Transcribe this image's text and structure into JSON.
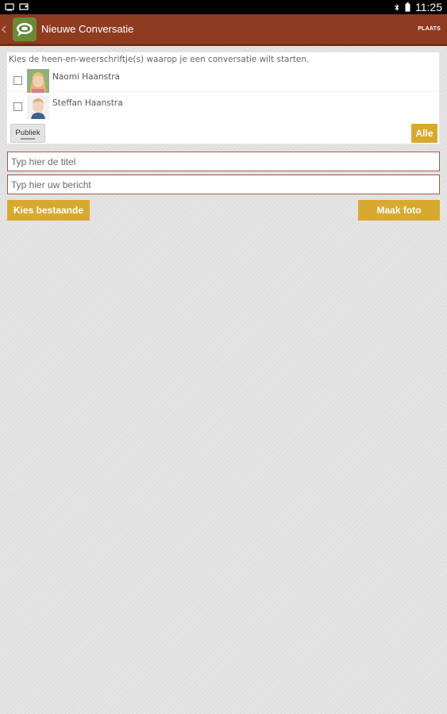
{
  "statusbar": {
    "time": "11:25",
    "left_icons": [
      "screenshot-icon",
      "cast-icon"
    ],
    "right_icons": [
      "bluetooth-icon",
      "battery-icon"
    ]
  },
  "actionbar": {
    "title": "Nieuwe Conversatie",
    "action_label": "PLAATS",
    "color": "#8f3b22"
  },
  "recipients": {
    "prompt": "Kies de heen-en-weerschriftje(s) waarop je een conversatie wilt starten.",
    "contacts": [
      {
        "name": "Naomi Haanstra",
        "checked": false
      },
      {
        "name": "Steffan Haanstra",
        "checked": false
      }
    ],
    "publiek_label": "Publiek",
    "alle_label": "Alle"
  },
  "form": {
    "title_placeholder": "Typ hier de titel",
    "message_placeholder": "Typ hier uw bericht",
    "title_value": "",
    "message_value": ""
  },
  "actions": {
    "choose_existing_label": "Kies bestaande",
    "take_photo_label": "Maak foto",
    "accent": "#d9a92f"
  }
}
